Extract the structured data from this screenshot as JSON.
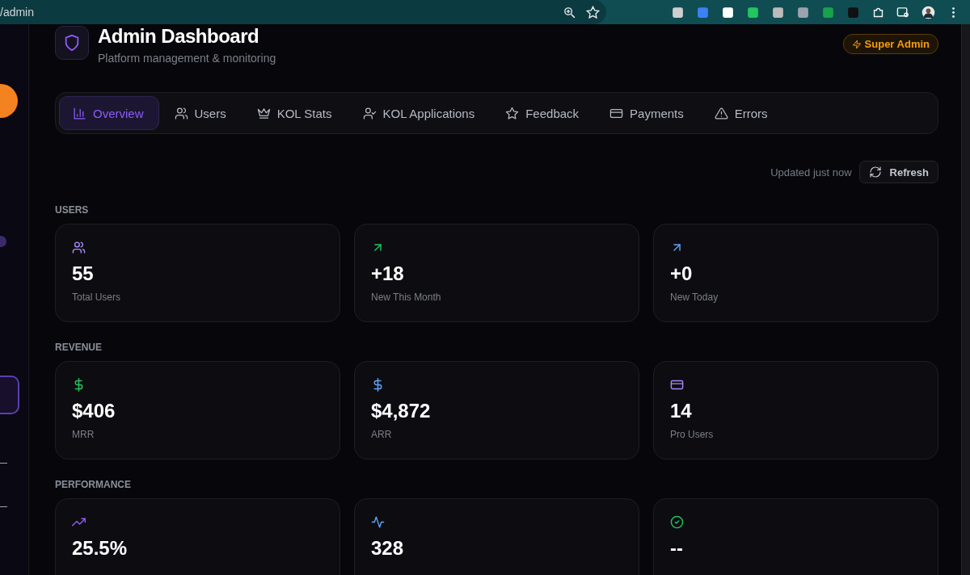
{
  "browser": {
    "url": "/admin"
  },
  "header": {
    "title": "Admin Dashboard",
    "subtitle": "Platform management & monitoring",
    "badge": "Super Admin"
  },
  "tabs": [
    {
      "label": "Overview",
      "selected": true
    },
    {
      "label": "Users",
      "selected": false
    },
    {
      "label": "KOL Stats",
      "selected": false
    },
    {
      "label": "KOL Applications",
      "selected": false
    },
    {
      "label": "Feedback",
      "selected": false
    },
    {
      "label": "Payments",
      "selected": false
    },
    {
      "label": "Errors",
      "selected": false
    }
  ],
  "refresh": {
    "status": "Updated just now",
    "button": "Refresh"
  },
  "sections": [
    {
      "title": "USERS",
      "cards": [
        {
          "value": "55",
          "label": "Total Users"
        },
        {
          "value": "+18",
          "label": "New This Month"
        },
        {
          "value": "+0",
          "label": "New Today"
        }
      ]
    },
    {
      "title": "REVENUE",
      "cards": [
        {
          "value": "$406",
          "label": "MRR"
        },
        {
          "value": "$4,872",
          "label": "ARR"
        },
        {
          "value": "14",
          "label": "Pro Users"
        }
      ]
    },
    {
      "title": "PERFORMANCE",
      "cards": [
        {
          "value": "25.5%"
        },
        {
          "value": "328"
        },
        {
          "value": "--"
        }
      ]
    }
  ]
}
